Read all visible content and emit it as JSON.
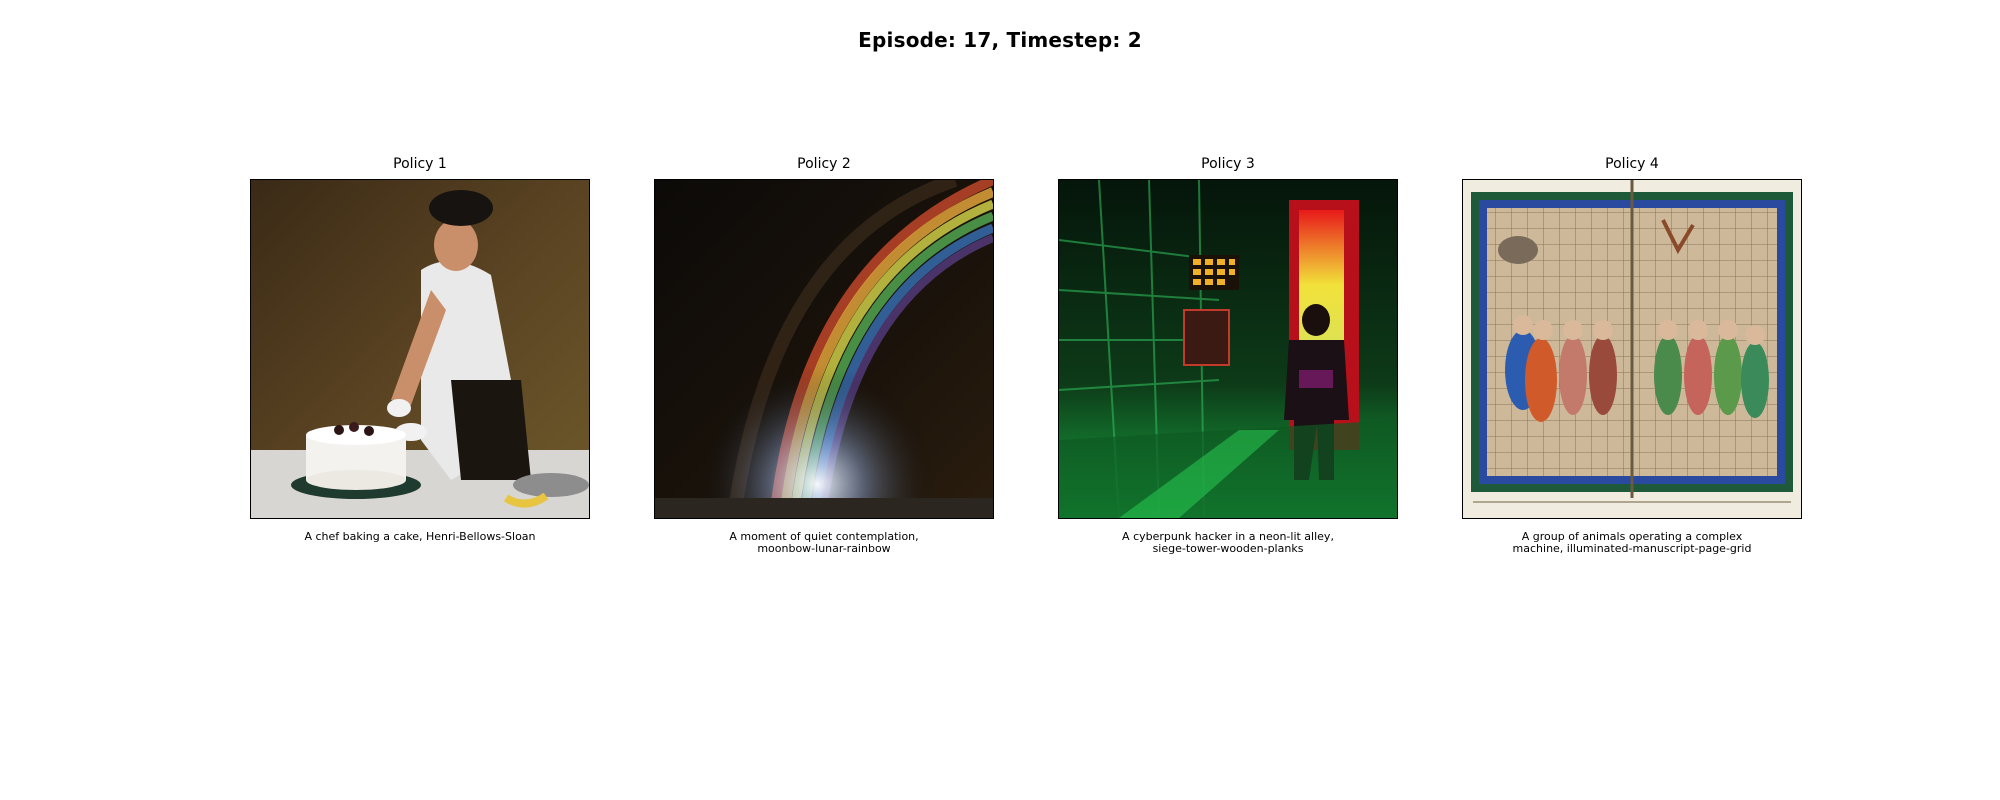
{
  "header": {
    "title": "Episode: 17, Timestep: 2"
  },
  "panels": [
    {
      "title": "Policy 1",
      "caption": "A chef baking a cake, Henri-Bellows-Sloan",
      "image_subject": "painted portrait of a chef decorating a white frosted cake"
    },
    {
      "title": "Policy 2",
      "caption": "A moment of quiet contemplation, moonbow-lunar-rainbow",
      "image_subject": "rainbow arc glowing over a dark horizon at night"
    },
    {
      "title": "Policy 3",
      "caption": "A cyberpunk hacker in a neon-lit alley, siege-tower-wooden-planks",
      "image_subject": "figure standing in a green and red neon lit corridor"
    },
    {
      "title": "Policy 4",
      "caption": "A group of animals operating a complex machine, illuminated-manuscript-page-grid",
      "image_subject": "open illuminated manuscript with figures and a grid"
    }
  ]
}
